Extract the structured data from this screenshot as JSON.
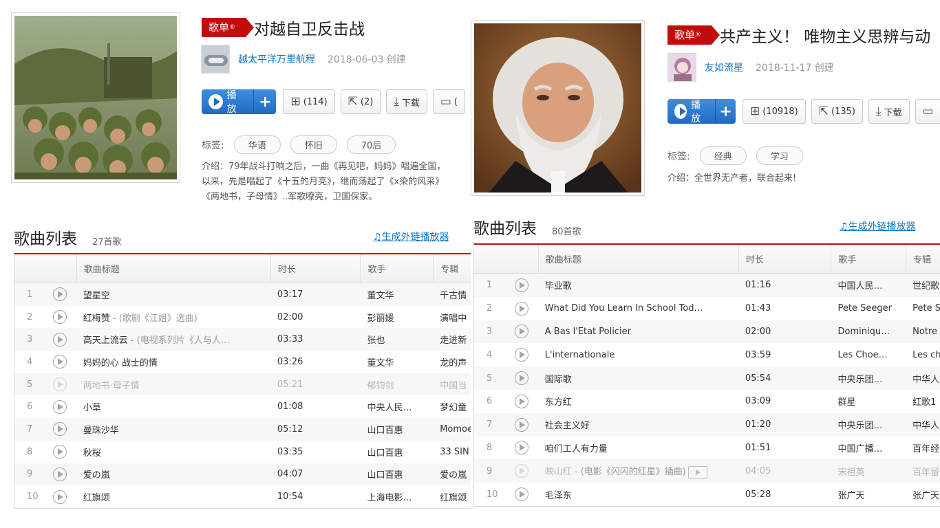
{
  "left": {
    "badge": "歌单",
    "badge_mark": "®",
    "title": "对越自卫反击战",
    "creator": "越太平洋万里航程",
    "create_date": "2018-06-03 创建",
    "play_label": "播放",
    "add_label": "+",
    "collect_label": "(114)",
    "share_label": "(2)",
    "download_label": "下载",
    "comment_label": "(",
    "tags_label": "标签:",
    "tags": [
      "华语",
      "怀旧",
      "70后"
    ],
    "intro_lines": [
      "介绍：79年战斗打响之后，一曲《再见吧，妈妈》唱遍全国，",
      "以来，先是唱起了《十五的月亮》，继而荡起了《x染的风采》",
      "《两地书，子母情》..军歌嘹亮，卫国保家。"
    ],
    "list_title": "歌曲列表",
    "count": "27首歌",
    "ext_link": "生成外链播放器",
    "headers": [
      "歌曲标题",
      "时长",
      "歌手",
      "专辑"
    ],
    "songs": [
      {
        "num": "1",
        "title": "望星空",
        "sub": "",
        "dur": "03:17",
        "artist": "董文华",
        "album": "千古情"
      },
      {
        "num": "2",
        "title": "红梅赞",
        "sub": " - (歌剧《江姐》选曲)",
        "dur": "02:00",
        "artist": "彭丽媛",
        "album": "演唱中"
      },
      {
        "num": "3",
        "title": "高天上流云",
        "sub": " - (电视系列片《人与人…",
        "dur": "03:33",
        "artist": "张也",
        "album": "走进新"
      },
      {
        "num": "4",
        "title": "妈妈的心 战士的情",
        "sub": "",
        "dur": "03:26",
        "artist": "董文华",
        "album": "龙的声"
      },
      {
        "num": "5",
        "title": "两地书·母子情",
        "sub": "",
        "dur": "05:21",
        "artist": "郁钧剑",
        "album": "中国当"
      },
      {
        "num": "6",
        "title": "小草",
        "sub": "",
        "dur": "01:08",
        "artist": "中央人民…",
        "album": "梦幻童"
      },
      {
        "num": "7",
        "title": "曼珠沙华",
        "sub": "",
        "dur": "05:12",
        "artist": "山口百惠",
        "album": "Momoe"
      },
      {
        "num": "8",
        "title": "秋桜",
        "sub": "",
        "dur": "03:35",
        "artist": "山口百惠",
        "album": "33 SIN"
      },
      {
        "num": "9",
        "title": "爱の嵐",
        "sub": "",
        "dur": "04:07",
        "artist": "山口百惠",
        "album": "爱の嵐"
      },
      {
        "num": "10",
        "title": "红旗颂",
        "sub": "",
        "dur": "10:54",
        "artist": "上海电影…",
        "album": "红旗颂"
      }
    ]
  },
  "right": {
    "badge": "歌单",
    "badge_mark": "®",
    "title": "共产主义！ 唯物主义思辨与动",
    "creator": "友如流星",
    "create_date": "2018-11-17 创建",
    "play_label": "播放",
    "add_label": "+",
    "collect_label": "(10918)",
    "share_label": "(135)",
    "download_label": "下载",
    "tags_label": "标签:",
    "tags": [
      "经典",
      "学习"
    ],
    "intro_lines": [
      "介绍：全世界无产者，联合起来!"
    ],
    "list_title": "歌曲列表",
    "count": "80首歌",
    "ext_link": "生成外链播放器",
    "headers": [
      "歌曲标题",
      "时长",
      "歌手",
      "专辑"
    ],
    "songs": [
      {
        "num": "1",
        "title": "毕业歌",
        "sub": "",
        "dur": "01:16",
        "artist": "中国人民…",
        "album": "世纪歌"
      },
      {
        "num": "2",
        "title": "What Did You Learn In School Tod…",
        "sub": "",
        "dur": "01:43",
        "artist": "Pete Seeger",
        "album": "Pete S"
      },
      {
        "num": "3",
        "title": "À Bas l'Etat Policier",
        "sub": "",
        "dur": "02:00",
        "artist": "Dominiqu…",
        "album": "Notre"
      },
      {
        "num": "4",
        "title": "L'internationale",
        "sub": "",
        "dur": "03:59",
        "artist": "Les Choe…",
        "album": "Les ch"
      },
      {
        "num": "5",
        "title": "国际歌",
        "sub": "",
        "dur": "05:54",
        "artist": "中央乐团…",
        "album": "中华人"
      },
      {
        "num": "6",
        "title": "东方红",
        "sub": "",
        "dur": "03:09",
        "artist": "群星",
        "album": "红歌1"
      },
      {
        "num": "7",
        "title": "社会主义好",
        "sub": "",
        "dur": "01:20",
        "artist": "中央乐团…",
        "album": "中华人"
      },
      {
        "num": "8",
        "title": "咱们工人有力量",
        "sub": "",
        "dur": "01:51",
        "artist": "中国广播…",
        "album": "百年经"
      },
      {
        "num": "9",
        "title": "映山红",
        "sub": " - (电影《闪闪的红星》插曲)",
        "dur": "04:05",
        "artist": "宋祖英",
        "album": "百年留"
      },
      {
        "num": "10",
        "title": "毛泽东",
        "sub": "",
        "dur": "05:28",
        "artist": "张广天",
        "album": "张广天"
      }
    ]
  }
}
